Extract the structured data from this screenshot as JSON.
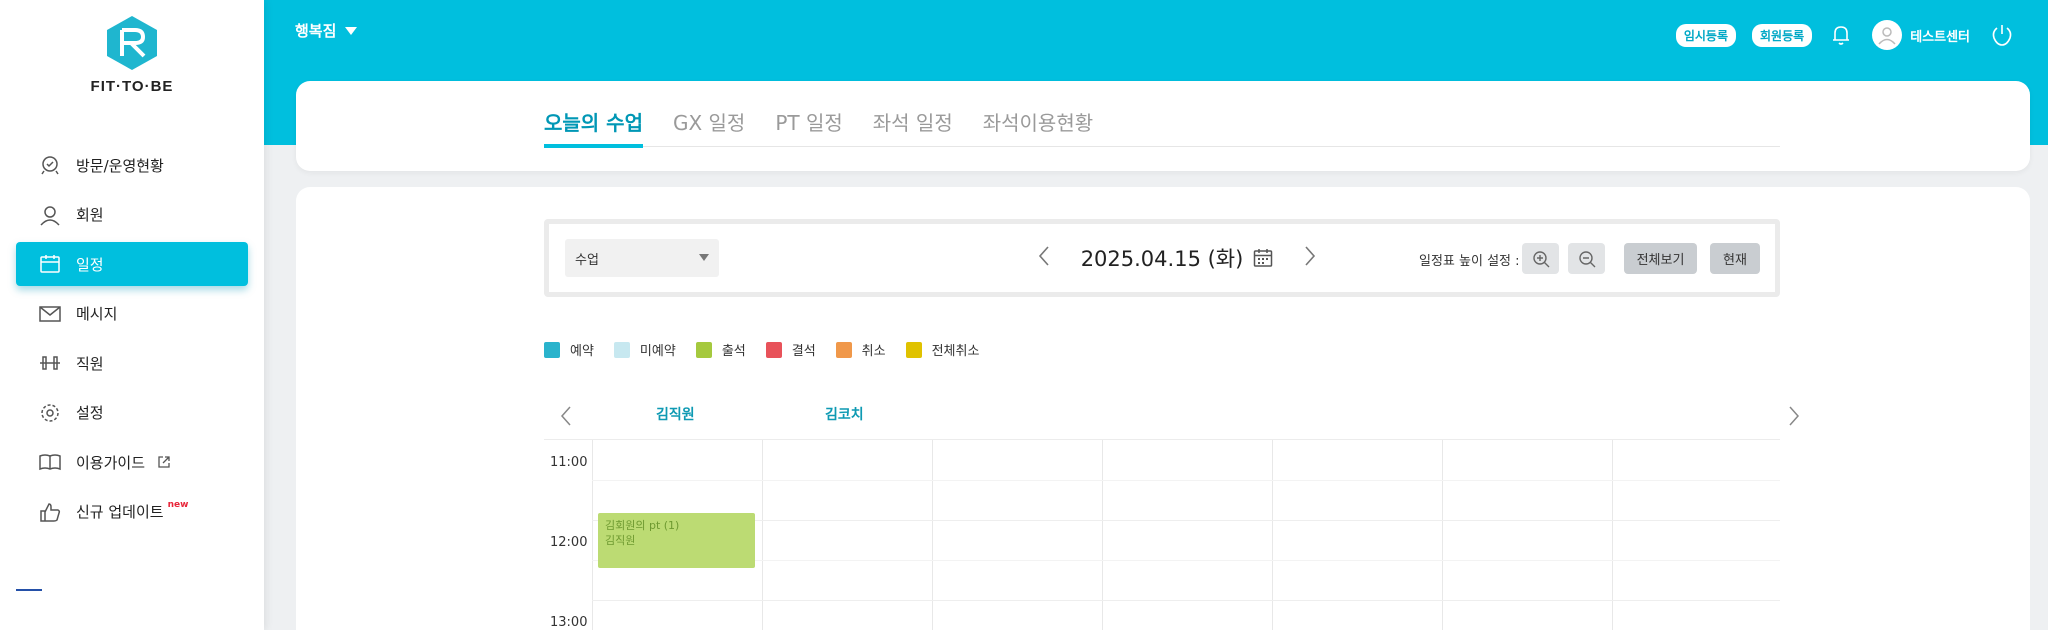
{
  "brand": {
    "logo_text": "FIT·TO·BE"
  },
  "sidebar": {
    "items": [
      {
        "label": "방문/운영현황",
        "icon": "visit-icon"
      },
      {
        "label": "회원",
        "icon": "user-icon"
      },
      {
        "label": "일정",
        "icon": "calendar-icon",
        "active": true
      },
      {
        "label": "메시지",
        "icon": "mail-icon"
      },
      {
        "label": "직원",
        "icon": "dumbbell-icon"
      },
      {
        "label": "설정",
        "icon": "gear-icon"
      },
      {
        "label": "이용가이드",
        "icon": "book-icon",
        "external": true
      },
      {
        "label": "신규 업데이트",
        "icon": "thumbs-up-icon",
        "badge": "new"
      }
    ]
  },
  "header": {
    "branch": "행복짐",
    "temp_register": "임시등록",
    "member_register": "회원등록",
    "user_name": "테스트센터"
  },
  "tabs": [
    {
      "label": "오늘의 수업",
      "active": true
    },
    {
      "label": "GX 일정"
    },
    {
      "label": "PT 일정"
    },
    {
      "label": "좌석 일정"
    },
    {
      "label": "좌석이용현황"
    }
  ],
  "controls": {
    "select_value": "수업",
    "date": "2025.04.15 (화)",
    "height_label": "일정표 높이 설정 :",
    "view_all": "전체보기",
    "now": "현재"
  },
  "legend": [
    {
      "label": "예약",
      "color": "#2ab3cc"
    },
    {
      "label": "미예약",
      "color": "#c7e8f0"
    },
    {
      "label": "출석",
      "color": "#a5c93e"
    },
    {
      "label": "결석",
      "color": "#e8525a"
    },
    {
      "label": "취소",
      "color": "#f0984a"
    },
    {
      "label": "전체취소",
      "color": "#e0c200"
    }
  ],
  "schedule": {
    "staff": [
      "김직원",
      "김코치"
    ],
    "times": [
      "11:00",
      "12:00",
      "13:00"
    ],
    "event": {
      "title": "김회원의 pt (1)",
      "staff": "김직원"
    }
  },
  "colors": {
    "accent": "#00bfde"
  }
}
